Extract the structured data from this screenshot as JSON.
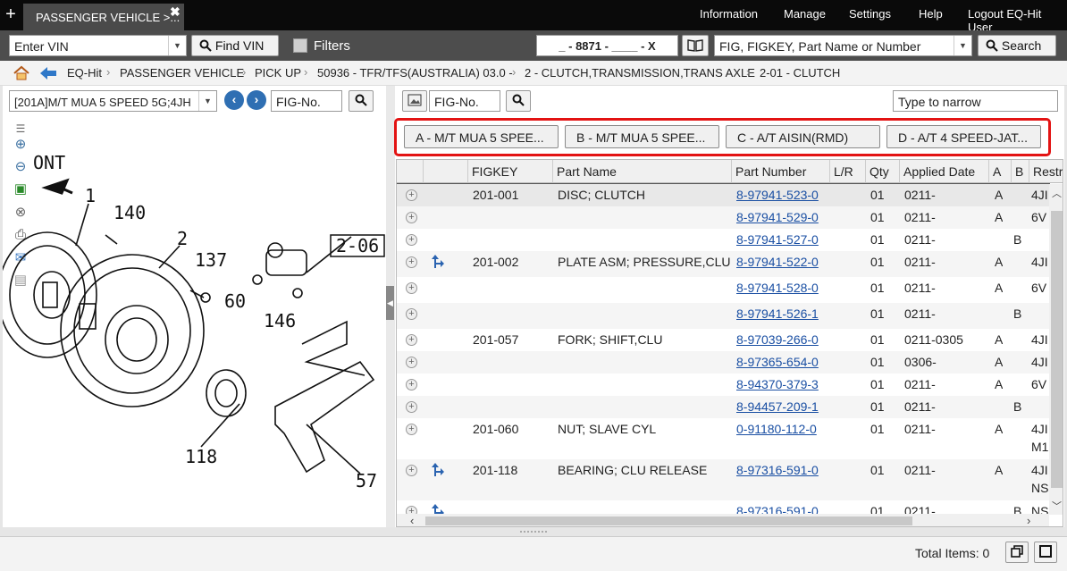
{
  "tab": {
    "title": "PASSENGER VEHICLE >..."
  },
  "menu": [
    "Information",
    "Manage",
    "Settings",
    "Help",
    "Logout EQ-Hit User"
  ],
  "toolbar": {
    "vin_placeholder": "Enter VIN",
    "find_vin": "Find VIN",
    "filters": "Filters",
    "code": "_ - 8871 - ____ - X",
    "search_placeholder": "FIG, FIGKEY, Part Name or Number",
    "search": "Search"
  },
  "breadcrumb": [
    "EQ-Hit",
    "PASSENGER VEHICLE",
    "PICK UP",
    "50936 - TFR/TFS(AUSTRALIA) 03.0 -",
    "2 - CLUTCH,TRANSMISSION,TRANS AXLE",
    "2-01 - CLUTCH"
  ],
  "left": {
    "model_select": "[201A]M/T MUA 5 SPEED 5G;4JH",
    "fig_placeholder": "FIG-No."
  },
  "diagram": {
    "labels": [
      "ONT",
      "1",
      "140",
      "2",
      "137",
      "2-06",
      "60",
      "146",
      "118",
      "57"
    ]
  },
  "right": {
    "fig_placeholder": "FIG-No.",
    "narrow_placeholder": "Type to narrow"
  },
  "variant_tabs": [
    "A - M/T MUA 5 SPEE...",
    "B - M/T MUA 5 SPEE...",
    "C - A/T AISIN(RMD)",
    "D - A/T 4 SPEED-JAT..."
  ],
  "grid": {
    "headers": [
      "FIGKEY",
      "Part Name",
      "Part Number",
      "L/R",
      "Qty",
      "Applied Date",
      "A",
      "B",
      "Restri"
    ],
    "rows": [
      {
        "figkey": "201-001",
        "name": "DISC; CLUTCH",
        "number": "8-97941-523-0",
        "lr": "",
        "qty": "01",
        "date": "0211-",
        "a": "A",
        "b": "",
        "restr": "4JI",
        "restr2": "",
        "flag": false
      },
      {
        "figkey": "",
        "name": "",
        "number": "8-97941-529-0",
        "lr": "",
        "qty": "01",
        "date": "0211-",
        "a": "A",
        "b": "",
        "restr": "6V",
        "restr2": "",
        "flag": false
      },
      {
        "figkey": "",
        "name": "",
        "number": "8-97941-527-0",
        "lr": "",
        "qty": "01",
        "date": "0211-",
        "a": "",
        "b": "B",
        "restr": "",
        "restr2": "",
        "flag": false
      },
      {
        "figkey": "201-002",
        "name": "PLATE ASM; PRESSURE,CLU",
        "number": "8-97941-522-0",
        "lr": "",
        "qty": "01",
        "date": "0211-",
        "a": "A",
        "b": "",
        "restr": "4JI",
        "restr2": "",
        "flag": true
      },
      {
        "figkey": "",
        "name": "",
        "number": "8-97941-528-0",
        "lr": "",
        "qty": "01",
        "date": "0211-",
        "a": "A",
        "b": "",
        "restr": "6V",
        "restr2": "",
        "flag": false
      },
      {
        "figkey": "",
        "name": "",
        "number": "8-97941-526-1",
        "lr": "",
        "qty": "01",
        "date": "0211-",
        "a": "",
        "b": "B",
        "restr": "",
        "restr2": "",
        "flag": false
      },
      {
        "figkey": "201-057",
        "name": "FORK; SHIFT,CLU",
        "number": "8-97039-266-0",
        "lr": "",
        "qty": "01",
        "date": "0211-0305",
        "a": "A",
        "b": "",
        "restr": "4JI",
        "restr2": "",
        "flag": false
      },
      {
        "figkey": "",
        "name": "",
        "number": "8-97365-654-0",
        "lr": "",
        "qty": "01",
        "date": "0306-",
        "a": "A",
        "b": "",
        "restr": "4JI",
        "restr2": "",
        "flag": false
      },
      {
        "figkey": "",
        "name": "",
        "number": "8-94370-379-3",
        "lr": "",
        "qty": "01",
        "date": "0211-",
        "a": "A",
        "b": "",
        "restr": "6V",
        "restr2": "",
        "flag": false
      },
      {
        "figkey": "",
        "name": "",
        "number": "8-94457-209-1",
        "lr": "",
        "qty": "01",
        "date": "0211-",
        "a": "",
        "b": "B",
        "restr": "",
        "restr2": "",
        "flag": false
      },
      {
        "figkey": "201-060",
        "name": "NUT; SLAVE CYL",
        "number": "0-91180-112-0",
        "lr": "",
        "qty": "01",
        "date": "0211-",
        "a": "A",
        "b": "",
        "restr": "4JI",
        "restr2": "M1",
        "flag": false
      },
      {
        "figkey": "201-118",
        "name": "BEARING; CLU RELEASE",
        "number": "8-97316-591-0",
        "lr": "",
        "qty": "01",
        "date": "0211-",
        "a": "A",
        "b": "",
        "restr": "4JI",
        "restr2": "NS",
        "flag": true
      },
      {
        "figkey": "",
        "name": "",
        "number": "8-97316-591-0",
        "lr": "",
        "qty": "01",
        "date": "0211-",
        "a": "",
        "b": "B",
        "restr": "NS",
        "restr2": "",
        "flag": true
      }
    ]
  },
  "status": {
    "total": "Total Items: 0"
  },
  "colors": {
    "accent": "#1a4fa3",
    "highlight": "#e31313",
    "dark": "#0a0a0a"
  }
}
